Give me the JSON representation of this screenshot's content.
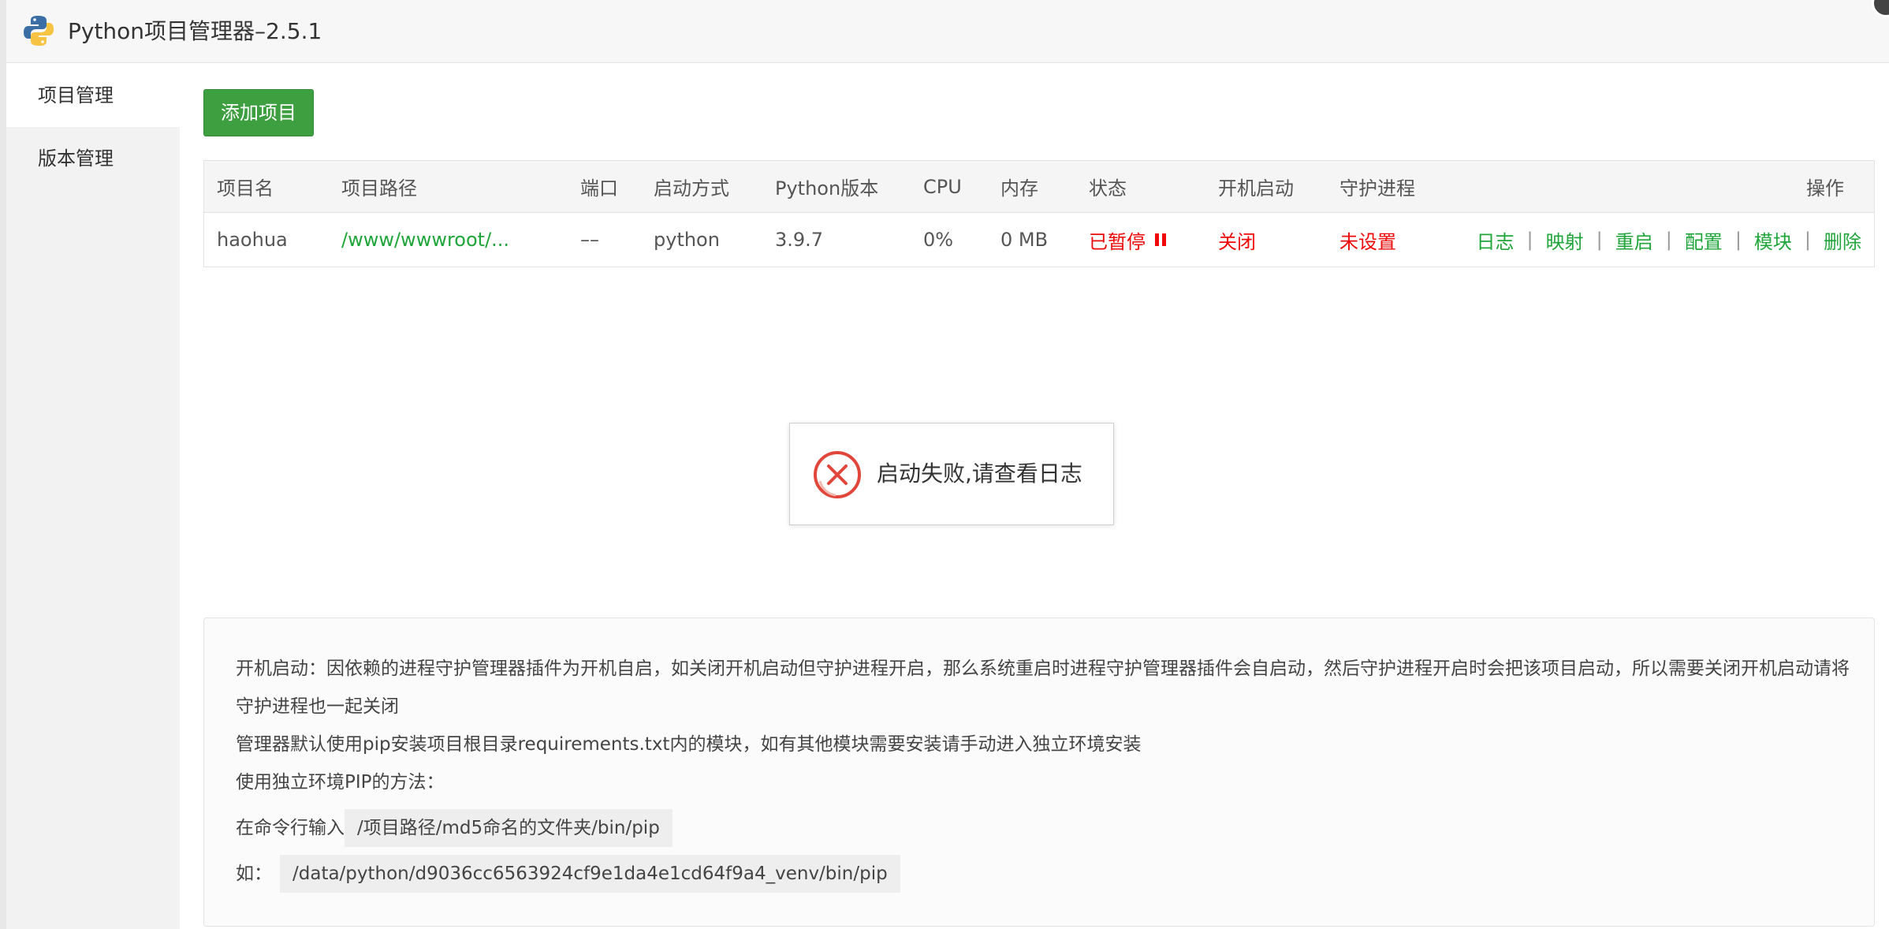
{
  "window": {
    "title": "Python项目管理器–2.5.1"
  },
  "sidebar": {
    "items": [
      {
        "label": "项目管理",
        "active": true
      },
      {
        "label": "版本管理",
        "active": false
      }
    ]
  },
  "toolbar": {
    "add_label": "添加项目"
  },
  "table": {
    "headers": {
      "name": "项目名",
      "path": "项目路径",
      "port": "端口",
      "start_mode": "启动方式",
      "python_version": "Python版本",
      "cpu": "CPU",
      "memory": "内存",
      "status": "状态",
      "boot_start": "开机启动",
      "daemon": "守护进程",
      "actions": "操作"
    },
    "rows": [
      {
        "name": "haohua",
        "path": "/www/wwwroot/...",
        "port": "––",
        "start_mode": "python",
        "python_version": "3.9.7",
        "cpu": "0%",
        "memory": "0 MB",
        "status": "已暂停",
        "boot_start": "关闭",
        "daemon": "未设置",
        "actions": {
          "log": "日志",
          "mapping": "映射",
          "restart": "重启",
          "config": "配置",
          "module": "模块",
          "delete": "删除"
        }
      }
    ]
  },
  "toast": {
    "message": "启动失败,请查看日志"
  },
  "tips": {
    "line1": "开机启动：因依赖的进程守护管理器插件为开机自启，如关闭开机启动但守护进程开启，那么系统重启时进程守护管理器插件会自启动，然后守护进程开启时会把该项目启动，所以需要关闭开机启动请将守护进程也一起关闭",
    "line2": "管理器默认使用pip安装项目根目录requirements.txt内的模块，如有其他模块需要安装请手动进入独立环境安装",
    "line3": "使用独立环境PIP的方法：",
    "line4_prefix": "在命令行输入",
    "line4_code": "/项目路径/md5命名的文件夹/bin/pip",
    "line5_prefix": "如：",
    "line5_code": "/data/python/d9036cc6563924cf9e1da4e1cd64f9a4_venv/bin/pip"
  },
  "colors": {
    "primary_green": "#3e9f40",
    "link_green": "#20a53a",
    "error_red": "#ef0808"
  }
}
